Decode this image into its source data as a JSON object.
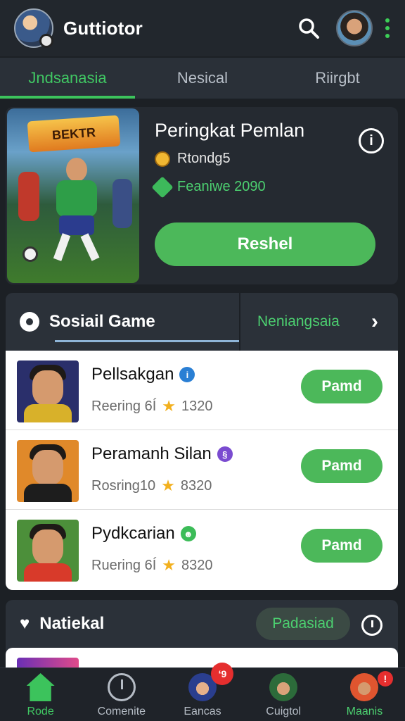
{
  "header": {
    "app_title": "Guttiotor"
  },
  "tabs": [
    {
      "label": "Jndsanasia",
      "active": true
    },
    {
      "label": "Nesical",
      "active": false
    },
    {
      "label": "Riirgbt",
      "active": false
    }
  ],
  "hero": {
    "image_logo_text": "BEKTR REPLINER",
    "title": "Peringkat Pemlan",
    "meta1": "Rtondg5",
    "meta2": "Feaniwe 2090",
    "button_label": "Reshel"
  },
  "social": {
    "title": "Sosiail Game",
    "secondary_label": "Neniangsaia",
    "items": [
      {
        "name": "Pellsakgan",
        "tag": "i",
        "tag_color": "#2a7fd4",
        "sub": "Reering 6Í",
        "score": "1320",
        "action": "Pamd",
        "thumb_bg": "#2a2f6b",
        "shirt": "#d8b12a"
      },
      {
        "name": "Peramanh Silan",
        "tag": "§",
        "tag_color": "#7a4bd0",
        "sub": "Rosring10",
        "score": "8320",
        "action": "Pamd",
        "thumb_bg": "#e0892a",
        "shirt": "#1d1d1d"
      },
      {
        "name": "Pydkcarian",
        "tag": "☻",
        "tag_color": "#3cbc58",
        "sub": "Ruering 6Í",
        "score": "8320",
        "action": "Pamd",
        "thumb_bg": "#4c8f3a",
        "shirt": "#d83a2a"
      }
    ]
  },
  "national": {
    "title": "Natiekal",
    "pill_label": "Padasiad"
  },
  "bottom_nav": [
    {
      "label": "Rode",
      "icon": "home-icon"
    },
    {
      "label": "Comenite",
      "icon": "timer-icon"
    },
    {
      "label": "Eancas",
      "icon": "avatar-icon",
      "badge": "ʻ9"
    },
    {
      "label": "Cuigtol",
      "icon": "avatar-icon"
    },
    {
      "label": "Maanis",
      "icon": "avatar-icon",
      "badge": "!"
    }
  ],
  "colors": {
    "accent": "#40c763",
    "button": "#4cb85a",
    "background": "#1c2025",
    "badge": "#e52e2e"
  }
}
